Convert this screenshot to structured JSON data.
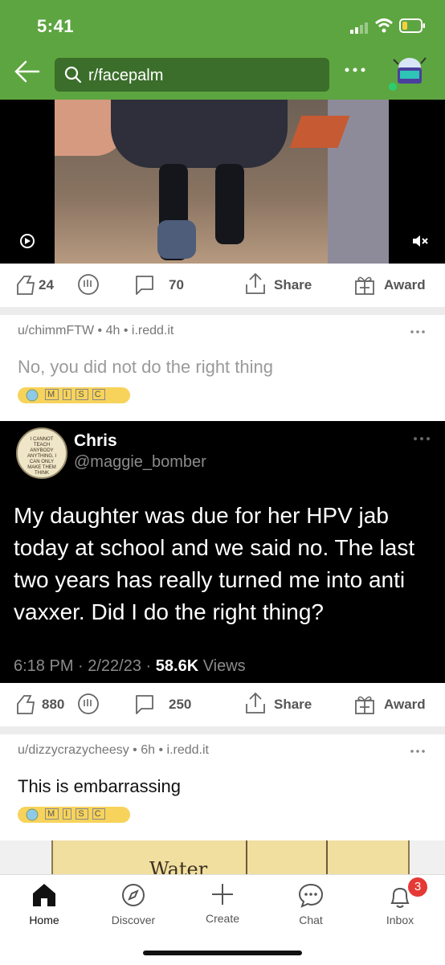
{
  "status_bar": {
    "time": "5:41"
  },
  "header": {
    "search_text": "r/facepalm",
    "more": "•••"
  },
  "post1": {
    "votes": "24",
    "comments": "70",
    "share": "Share",
    "award": "Award"
  },
  "post2": {
    "author": "u/chimmFTW",
    "age": "4h",
    "domain": "i.redd.it",
    "title": "No, you did not do the right thing",
    "flair": [
      "M",
      "I",
      "S",
      "C"
    ],
    "tweet": {
      "name": "Chris",
      "handle": "@maggie_bomber",
      "avatar_text": "I CANNOT TEACH ANYBODY ANYTHING, I CAN ONLY MAKE THEM THINK",
      "body": "My daughter was due for her HPV jab today at school and we said no. The last two years has really turned me into anti vaxxer. Did I do the right thing?",
      "timestamp": "6:18 PM · 2/22/23 · ",
      "views_count": "58.6K",
      "views_label": " Views"
    },
    "votes": "880",
    "comments": "250",
    "share": "Share",
    "award": "Award"
  },
  "post3": {
    "author": "u/dizzycrazycheesy",
    "age": "6h",
    "domain": "i.redd.it",
    "title": "This is embarrassing",
    "flair": [
      "M",
      "I",
      "S",
      "C"
    ],
    "image_text": "Water"
  },
  "nav": {
    "home": "Home",
    "discover": "Discover",
    "create": "Create",
    "chat": "Chat",
    "inbox": "Inbox",
    "inbox_badge": "3"
  },
  "colors": {
    "brand_green": "#5da540",
    "flair_yellow": "#f7d35c",
    "badge_red": "#e53935"
  }
}
